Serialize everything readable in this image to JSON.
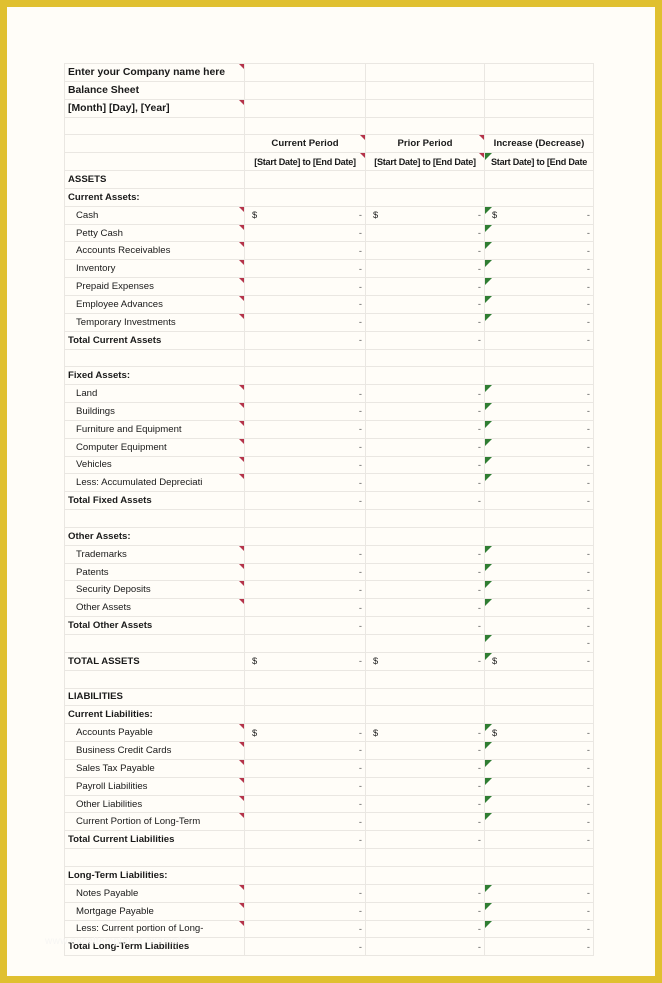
{
  "document": {
    "company_line": "Enter your Company name here",
    "doc_title": "Balance Sheet",
    "date_line": "[Month] [Day], [Year]",
    "watermark": "www.exceltemplates.example"
  },
  "columns": {
    "label_header": "",
    "current_period": "Current Period",
    "prior_period": "Prior Period",
    "increase_decrease": "Increase (Decrease)",
    "current_period_range": "[Start Date] to [End Date]",
    "prior_period_range": "[Start Date] to [End Date]",
    "increase_decrease_range": "Start Date] to [End Date"
  },
  "symbols": {
    "currency": "$",
    "dash": "-"
  },
  "sections": {
    "assets_header": "ASSETS",
    "current_assets_header": "Current Assets:",
    "current_assets_items": [
      "Cash",
      "Petty Cash",
      "Accounts Receivables",
      "Inventory",
      "Prepaid Expenses",
      "Employee Advances",
      "Temporary Investments"
    ],
    "total_current_assets": "Total Current Assets",
    "fixed_assets_header": "Fixed Assets:",
    "fixed_assets_items": [
      "Land",
      "Buildings",
      "Furniture and Equipment",
      "Computer Equipment",
      "Vehicles",
      "Less: Accumulated Depreciati"
    ],
    "total_fixed_assets": "Total Fixed Assets",
    "other_assets_header": "Other Assets:",
    "other_assets_items": [
      "Trademarks",
      "Patents",
      "Security Deposits",
      "Other Assets"
    ],
    "total_other_assets": "Total Other Assets",
    "total_assets": "TOTAL ASSETS",
    "liabilities_header": "LIABILITIES",
    "current_liabilities_header": "Current Liabilities:",
    "current_liabilities_items": [
      "Accounts Payable",
      "Business Credit Cards",
      "Sales Tax Payable",
      "Payroll Liabilities",
      "Other Liabilities",
      "Current Portion of Long-Term"
    ],
    "total_current_liabilities": "Total Current Liabilities",
    "longterm_liabilities_header": "Long-Term Liabilities:",
    "longterm_liabilities_items": [
      "Notes Payable",
      "Mortgage Payable",
      "Less: Current portion of Long-"
    ],
    "total_longterm_liabilities": "Total Long-Term Liabilities"
  },
  "colors": {
    "page_border": "#e0c030",
    "comment_marker": "#b5334a",
    "error_marker": "#2f7d32",
    "grid_line": "#eae7e2",
    "total_rule": "#111111"
  }
}
